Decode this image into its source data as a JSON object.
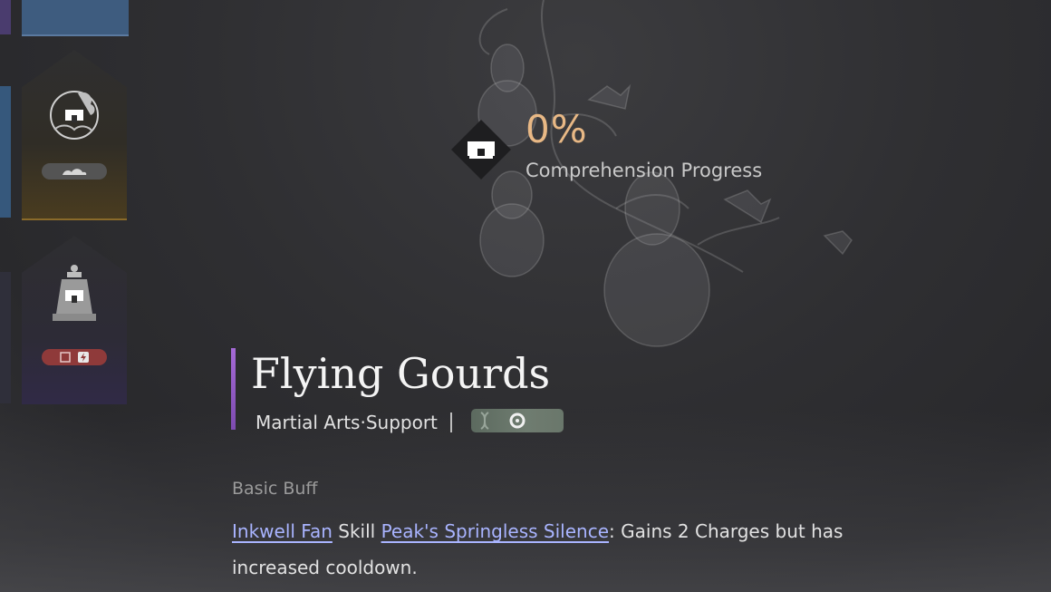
{
  "progress": {
    "value": "0%",
    "label": "Comprehension Progress",
    "value_color": "#e8b885"
  },
  "skill": {
    "title": "Flying Gourds",
    "type": "Martial Arts·Support",
    "accent_color": "#a56ad6"
  },
  "description": {
    "heading": "Basic Buff",
    "link1": "Inkwell Fan",
    "word_skill": "Skill",
    "link2": "Peak's Springless Silence",
    "rest_line1": ": Gains 2 Charges but has",
    "rest_line2": "increased cooldown.",
    "link_color": "#a9b4ff"
  },
  "left_slots": [
    {
      "icon": "gourd-cloud-icon",
      "bar_icon": "cloud-icon",
      "theme": "gold"
    },
    {
      "icon": "bell-icon",
      "bar_icons": [
        "scroll-icon",
        "lightning-icon"
      ],
      "theme": "purple"
    }
  ]
}
